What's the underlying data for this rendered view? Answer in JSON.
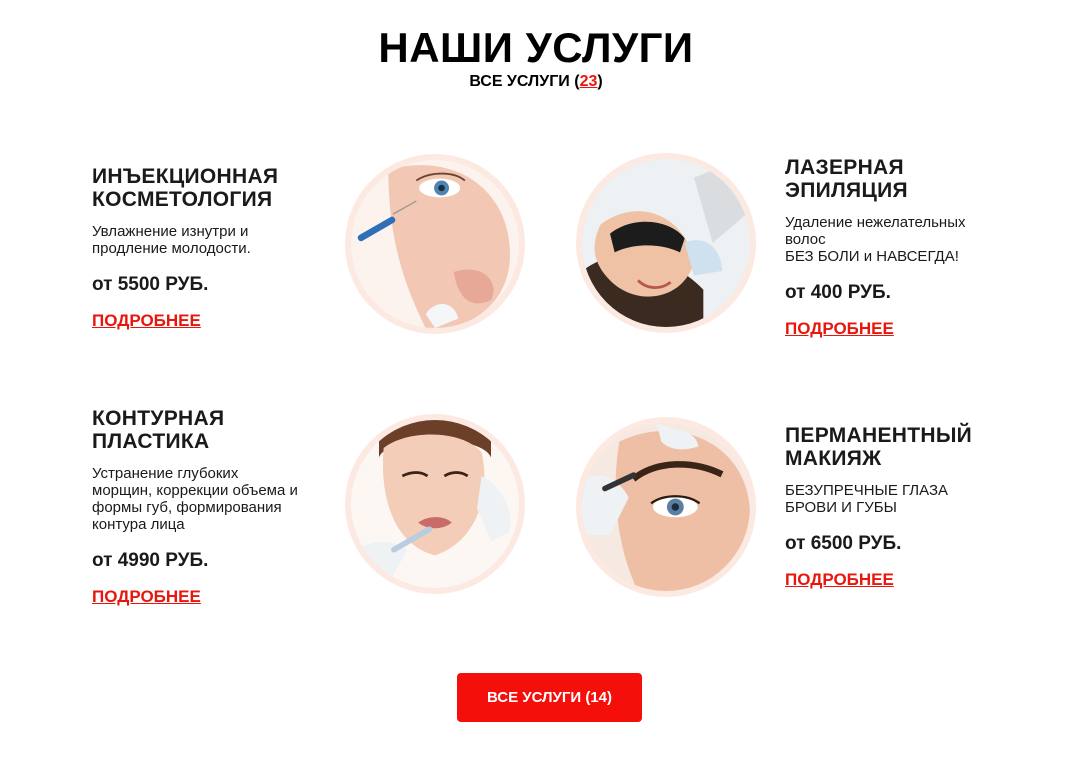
{
  "header": {
    "title": "НАШИ УСЛУГИ",
    "all_prefix": "ВСЕ УСЛУГИ (",
    "all_count": "23",
    "all_suffix": ")"
  },
  "services": [
    {
      "title": "ИНЪЕКЦИОННАЯ\nКОСМЕТОЛОГИЯ",
      "description": "Увлажнение изнутри и\nпродление молодости.",
      "price": "от 5500 РУБ.",
      "link": "ПОДРОБНЕЕ",
      "image": "injection-cosmetology-photo"
    },
    {
      "title": "ЛАЗЕРНАЯ\nЭПИЛЯЦИЯ",
      "description": "Удаление нежелательных\nволос\nБЕЗ БОЛИ и НАВСЕГДА!",
      "price": "от 400 РУБ.",
      "link": "ПОДРОБНЕЕ",
      "image": "laser-epilation-photo"
    },
    {
      "title": "КОНТУРНАЯ\nПЛАСТИКА",
      "description": "Устранение глубоких\nморщин, коррекции объема и\nформы губ, формирования\nконтура лица",
      "price": "от 4990 РУБ.",
      "link": "ПОДРОБНЕЕ",
      "image": "contour-plastic-photo"
    },
    {
      "title": "ПЕРМАНЕНТНЫЙ\nМАКИЯЖ",
      "description": "БЕЗУПРЕЧНЫЕ ГЛАЗА\nБРОВИ И ГУБЫ",
      "price": "от 6500 РУБ.",
      "link": "ПОДРОБНЕЕ",
      "image": "permanent-makeup-photo"
    }
  ],
  "footer": {
    "all_button": "ВСЕ УСЛУГИ (14)"
  },
  "colors": {
    "accent": "#e8160c",
    "button": "#f40f0a",
    "photo_ring": "#fbe9e2"
  }
}
